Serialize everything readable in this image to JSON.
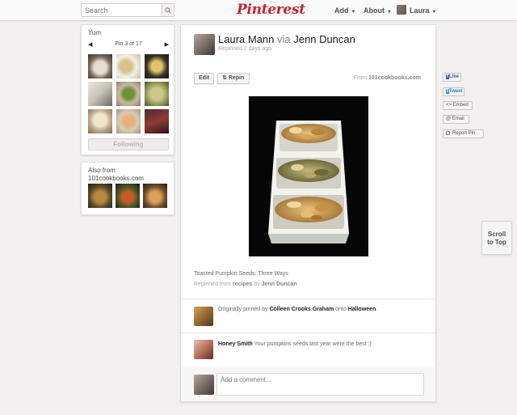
{
  "header": {
    "search_placeholder": "Search",
    "logo": "Pinterest",
    "add_label": "Add",
    "about_label": "About",
    "user_label": "Laura"
  },
  "board_card": {
    "title": "Yum",
    "pin_position": "Pin 3 of 17",
    "following_label": "Following"
  },
  "also_card": {
    "title_line1": "Also from",
    "title_line2": "101cookbooks.com"
  },
  "pin": {
    "author": "Laura Mann",
    "via": "via",
    "via_user": "Jenn Duncan",
    "repinned_time": "Repinned 7 days ago",
    "edit_label": "Edit",
    "repin_label": "Repin",
    "from_prefix": "From",
    "from_source": "101cookbooks.com",
    "caption": "Toasted Pumpkin Seeds: Three Ways",
    "repinned_from_prefix": "Repinned from",
    "repinned_from_board": "recipes",
    "repinned_by_prefix": "by",
    "repinned_by_user": "Jenn Duncan"
  },
  "activity": [
    {
      "prefix": "Originally pinned by",
      "user": "Colleen Crooks Graham",
      "middle": "onto",
      "board": "Halloween",
      "suffix": "."
    },
    {
      "user": "Honey Smith",
      "text": "Your pumpkins seeds last year were the best :)"
    }
  ],
  "comment_placeholder": "Add a comment...",
  "share": {
    "like": "Like",
    "tweet": "Tweet",
    "embed": "<> Embed",
    "email": "@ Email",
    "report": "Report Pin"
  },
  "scroll_top": {
    "line1": "Scroll",
    "line2": "to Top"
  },
  "colors": {
    "brand": "#c8232c",
    "background": "#f2f0f0",
    "facebook": "#3b5998"
  }
}
